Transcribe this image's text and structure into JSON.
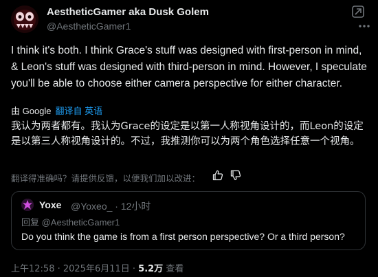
{
  "author": {
    "display_name": "AestheticGamer aka Dusk Golem",
    "handle": "@AestheticGamer1"
  },
  "icons": {
    "avatar": "skull-avatar-icon",
    "grok": "grok-icon",
    "more": "more-options-icon",
    "thumb_up": "thumb-up-icon",
    "thumb_down": "thumb-down-icon"
  },
  "tweet": {
    "text": "I think it's both. I think Grace's stuff was designed with first-person in mind, & Leon's stuff was designed with third-person in mind. However, I speculate you'll be able to choose either camera perspective for either character."
  },
  "translation": {
    "by_label": "由 Google",
    "link_label": "翻译自 英语",
    "text": "我认为两者都有。我认为Grace的设定是以第一人称视角设计的，而Leon的设定是以第三人称视角设计的。不过，我推测你可以为两个角色选择任意一个视角。",
    "rate_prompt": "翻译得准确吗？请提供反馈，以便我们加以改进："
  },
  "quote": {
    "display_name": "Yoxe",
    "handle_time": "@Yoxeo_ · 12小时",
    "reply_to": "回复 @AestheticGamer1",
    "text": "Do you think the game is from a first person perspective? Or a third person?"
  },
  "meta": {
    "time_date": "上午12:58 · 2025年6月11日 · ",
    "views_count": "5.2万",
    "views_label": " 查看"
  },
  "colors": {
    "background": "#000000",
    "text": "#e7e9ea",
    "muted": "#71767b",
    "link": "#1d9bf0",
    "border": "#2f3336"
  }
}
